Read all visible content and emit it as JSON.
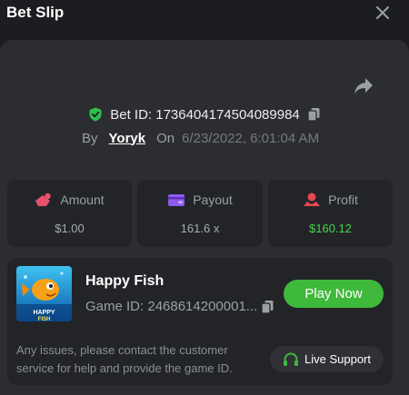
{
  "header": {
    "title": "Bet Slip"
  },
  "bet": {
    "id_label": "Bet ID: 1736404174504089984",
    "by": "By",
    "user": "Yoryk",
    "on": "On",
    "date": "6/23/2022, 6:01:04 AM"
  },
  "stats": [
    {
      "label": "Amount",
      "value": "$1.00"
    },
    {
      "label": "Payout",
      "value": "161.6 x"
    },
    {
      "label": "Profit",
      "value": "$160.12"
    }
  ],
  "game": {
    "name": "Happy Fish",
    "game_id": "Game ID: 2468614200001...",
    "play_label": "Play Now",
    "thumb_text": "HAPPY FISH"
  },
  "support": {
    "note": "Any issues, please contact the customer service for help and provide the game ID.",
    "button_label": "Live Support"
  },
  "colors": {
    "accent_green": "#3fb93c",
    "profit_green": "#47d14f",
    "icon_pink": "#e8516b",
    "icon_purple": "#8e5bf0",
    "icon_red": "#e8474e"
  }
}
